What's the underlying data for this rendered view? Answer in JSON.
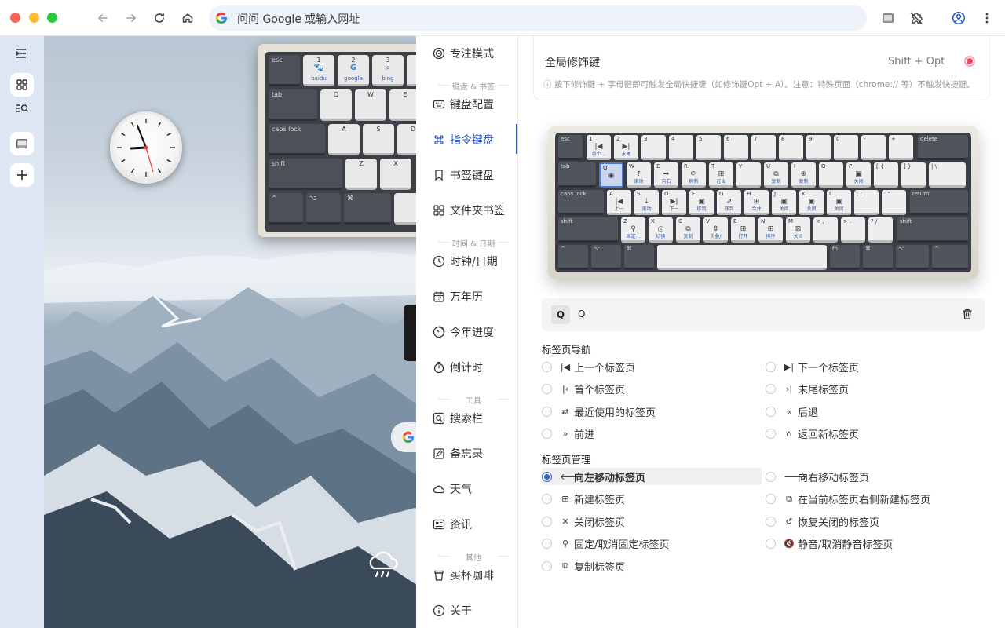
{
  "browser": {
    "omnibox_text": "问问 Google 或输入网址",
    "icons": [
      "back-icon",
      "forward-icon",
      "reload-icon",
      "home-icon",
      "google-g-icon",
      "extension-icon",
      "puzzle-icon",
      "profile-icon",
      "menu-icon"
    ]
  },
  "rail": {
    "items": [
      "collapse-icon",
      "apps-icon",
      "search-list-icon",
      "keyboard-icon",
      "add-icon"
    ]
  },
  "wallpaper": {
    "mini_keyboard": {
      "row1": [
        {
          "num": "1",
          "label": "baidu"
        },
        {
          "num": "2",
          "label": "google"
        },
        {
          "num": "3",
          "label": "bing"
        }
      ],
      "esc": "esc",
      "tab": "tab",
      "caps": "caps lock",
      "shift": "shift",
      "letters_row2": [
        "Q",
        "W",
        "E"
      ],
      "letters_row3": [
        "A",
        "S",
        "D"
      ],
      "letters_row4": [
        "Z",
        "X"
      ],
      "bottom": [
        "^",
        "⌥",
        "⌘"
      ]
    }
  },
  "nav": {
    "items": [
      {
        "label": "专注模式",
        "icon": "target-icon"
      },
      {
        "label": "键盘配置",
        "icon": "keyboard-icon"
      },
      {
        "label": "指令键盘",
        "icon": "command-icon"
      },
      {
        "label": "书签键盘",
        "icon": "bookmark-icon"
      },
      {
        "label": "文件夹书签",
        "icon": "grid-icon"
      },
      {
        "label": "时钟/日期",
        "icon": "clock-icon"
      },
      {
        "label": "万年历",
        "icon": "calendar-icon"
      },
      {
        "label": "今年进度",
        "icon": "progress-icon"
      },
      {
        "label": "倒计时",
        "icon": "timer-icon"
      },
      {
        "label": "搜索栏",
        "icon": "search-icon"
      },
      {
        "label": "备忘录",
        "icon": "memo-icon"
      },
      {
        "label": "天气",
        "icon": "cloud-icon"
      },
      {
        "label": "资讯",
        "icon": "news-icon"
      },
      {
        "label": "买杯咖啡",
        "icon": "coffee-icon"
      },
      {
        "label": "关于",
        "icon": "info-icon"
      }
    ],
    "sections": [
      "键盘 & 书签",
      "时间 & 日期",
      "工具",
      "其他"
    ],
    "active": "指令键盘"
  },
  "modifier": {
    "title": "全局修饰键",
    "value": "Shift + Opt",
    "tip": "ⓘ 按下修饰键 + 字母键即可触发全局快捷键（如修饰键Opt + A）。注意：特殊页面（chrome:// 等）不触发快捷键。"
  },
  "keyboard": {
    "esc": "esc",
    "delete": "delete",
    "tab": "tab",
    "caps": "caps lock",
    "return": "return",
    "shift": "shift",
    "fn": "fn",
    "row1": [
      {
        "k": "1",
        "i": "|◀",
        "l": "首个..."
      },
      {
        "k": "2",
        "i": "▶|",
        "l": "末尾"
      },
      {
        "k": "3",
        "i": "",
        "l": ""
      },
      {
        "k": "4",
        "i": "",
        "l": ""
      },
      {
        "k": "5",
        "i": "",
        "l": ""
      },
      {
        "k": "6",
        "i": "",
        "l": ""
      },
      {
        "k": "7",
        "i": "",
        "l": ""
      },
      {
        "k": "8",
        "i": "",
        "l": ""
      },
      {
        "k": "9",
        "i": "",
        "l": ""
      },
      {
        "k": "0",
        "i": "",
        "l": ""
      },
      {
        "k": "-",
        "i": "",
        "l": ""
      },
      {
        "k": "+",
        "i": "",
        "l": ""
      }
    ],
    "row2": [
      {
        "k": "Q",
        "i": "◉",
        "l": ""
      },
      {
        "k": "W",
        "i": "⇡",
        "l": "滚动"
      },
      {
        "k": "E",
        "i": "➡",
        "l": "向右"
      },
      {
        "k": "R",
        "i": "⟳",
        "l": "刷新"
      },
      {
        "k": "T",
        "i": "⊞",
        "l": "在当"
      },
      {
        "k": "Y",
        "i": "",
        "l": ""
      },
      {
        "k": "U",
        "i": "⧉",
        "l": "复制"
      },
      {
        "k": "I",
        "i": "⊕",
        "l": "复制"
      },
      {
        "k": "O",
        "i": "",
        "l": ""
      },
      {
        "k": "P",
        "i": "▣",
        "l": "关闭"
      },
      {
        "k": "[ {",
        "i": "",
        "l": ""
      },
      {
        "k": "] }",
        "i": "",
        "l": ""
      },
      {
        "k": "| \\",
        "i": "",
        "l": ""
      }
    ],
    "row3": [
      {
        "k": "A",
        "i": "|◀",
        "l": "上一"
      },
      {
        "k": "S",
        "i": "⇣",
        "l": "滚动"
      },
      {
        "k": "D",
        "i": "▶|",
        "l": "下一"
      },
      {
        "k": "F",
        "i": "▣",
        "l": "移到"
      },
      {
        "k": "G",
        "i": "⇗",
        "l": "移到"
      },
      {
        "k": "H",
        "i": "⊞",
        "l": "合并"
      },
      {
        "k": "J",
        "i": "▣",
        "l": "关闭"
      },
      {
        "k": "K",
        "i": "▣",
        "l": "关闭"
      },
      {
        "k": "L",
        "i": "▣",
        "l": "关闭"
      },
      {
        "k": "; :",
        "i": "",
        "l": ""
      },
      {
        "k": "' \"",
        "i": "",
        "l": ""
      }
    ],
    "row4": [
      {
        "k": "Z",
        "i": "⚲",
        "l": "固定..."
      },
      {
        "k": "X",
        "i": "◎",
        "l": "切换"
      },
      {
        "k": "C",
        "i": "⧉",
        "l": "复制"
      },
      {
        "k": "V",
        "i": "⇕",
        "l": "折叠/"
      },
      {
        "k": "B",
        "i": "⊞",
        "l": "打开"
      },
      {
        "k": "N",
        "i": "⊞",
        "l": "排序"
      },
      {
        "k": "M",
        "i": "⊠",
        "l": "关闭"
      },
      {
        "k": "< ,",
        "i": "",
        "l": ""
      },
      {
        "k": "> .",
        "i": "",
        "l": ""
      },
      {
        "k": "? /",
        "i": "",
        "l": ""
      }
    ],
    "row5": [
      "^",
      "⌥",
      "⌘",
      "fn",
      "⌘",
      "⌥",
      "^"
    ]
  },
  "key_detail": {
    "cap": "Q",
    "value": "Q"
  },
  "groups": [
    {
      "title": "标签页导航",
      "options": [
        {
          "icon": "|◀",
          "label": "上一个标签页"
        },
        {
          "icon": "▶|",
          "label": "下一个标签页"
        },
        {
          "icon": "|‹",
          "label": "首个标签页"
        },
        {
          "icon": "›|",
          "label": "末尾标签页"
        },
        {
          "icon": "⇄",
          "label": "最近使用的标签页"
        },
        {
          "icon": "«",
          "label": "后退"
        },
        {
          "icon": "»",
          "label": "前进"
        },
        {
          "icon": "⌂",
          "label": "返回新标签页"
        }
      ]
    },
    {
      "title": "标签页管理",
      "options": [
        {
          "icon": "🡐",
          "label": "向左移动标签页",
          "checked": true
        },
        {
          "icon": "🡒",
          "label": "向右移动标签页"
        },
        {
          "icon": "⊞",
          "label": "新建标签页"
        },
        {
          "icon": "⧉",
          "label": "在当前标签页右侧新建标签页"
        },
        {
          "icon": "✕",
          "label": "关闭标签页"
        },
        {
          "icon": "↺",
          "label": "恢复关闭的标签页"
        },
        {
          "icon": "⚲",
          "label": "固定/取消固定标签页"
        },
        {
          "icon": "🔇",
          "label": "静音/取消静音标签页"
        },
        {
          "icon": "⧉",
          "label": "复制标签页"
        }
      ]
    }
  ],
  "colors": {
    "accent": "#2757c9",
    "radio": "#2f63d4",
    "modifier_dot": "#ec4a6a"
  }
}
